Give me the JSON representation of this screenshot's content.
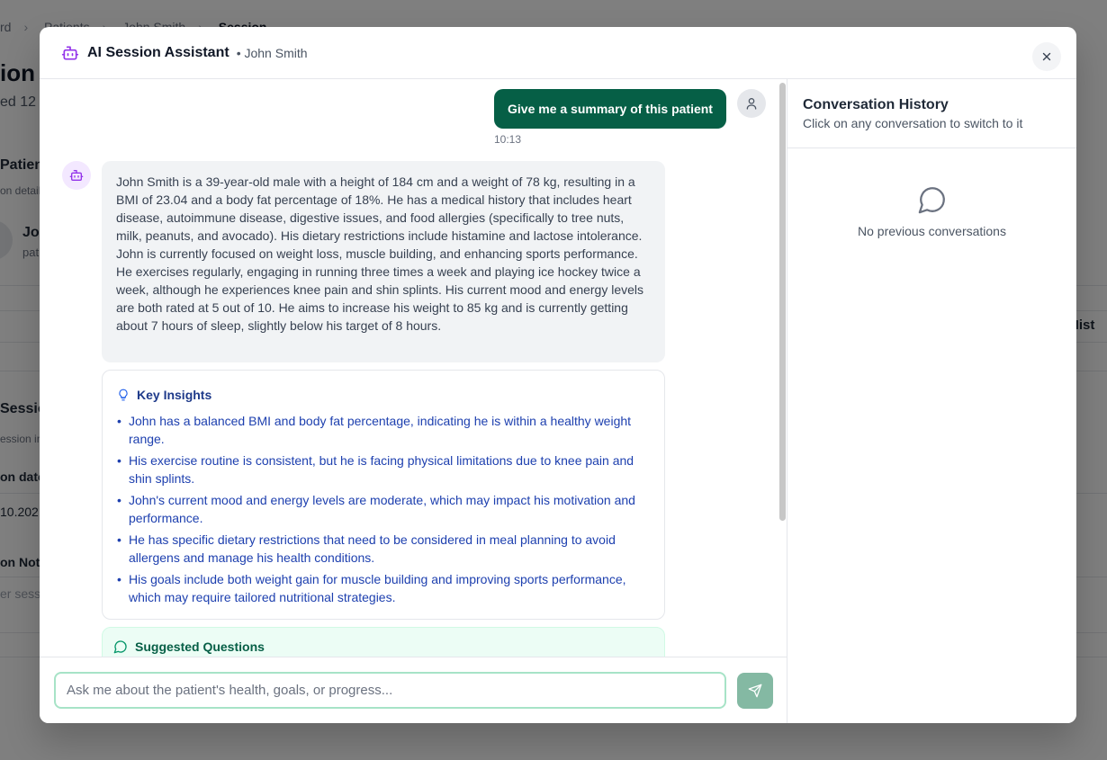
{
  "background": {
    "breadcrumb": [
      "rd",
      "Patients",
      "John Smith",
      "Session"
    ],
    "title": "ion",
    "subtitle": "ed 12",
    "patient_heading": "Patien",
    "patient_desc": "on detail",
    "patient_initials": "Jo",
    "patient_sub": "pat",
    "history_tab": "Hist",
    "session_heading": "Sessio",
    "session_desc": "ession in",
    "date_label": "on date",
    "date_value": "10.202",
    "notes_label": "on Not",
    "notes_value": "er sess"
  },
  "modal": {
    "title": "AI Session Assistant",
    "patient": "• John Smith",
    "close_label": "Close"
  },
  "chat": {
    "user_message": "Give me a summary of this patient",
    "user_time": "10:13",
    "assistant_message": "John Smith is a 39-year-old male with a height of 184 cm and a weight of 78 kg, resulting in a BMI of 23.04 and a body fat percentage of 18%. He has a medical history that includes heart disease, autoimmune disease, digestive issues, and food allergies (specifically to tree nuts, milk, peanuts, and avocado). His dietary restrictions include histamine and lactose intolerance. John is currently focused on weight loss, muscle building, and enhancing sports performance. He exercises regularly, engaging in running three times a week and playing ice hockey twice a week, although he experiences knee pain and shin splints. His current mood and energy levels are both rated at 5 out of 10. He aims to increase his weight to 85 kg and is currently getting about 7 hours of sleep, slightly below his target of 8 hours.",
    "insights_title": "Key Insights",
    "insights": [
      "John has a balanced BMI and body fat percentage, indicating he is within a healthy weight range.",
      "His exercise routine is consistent, but he is facing physical limitations due to knee pain and shin splints.",
      "John's current mood and energy levels are moderate, which may impact his motivation and performance.",
      "He has specific dietary restrictions that need to be considered in meal planning to avoid allergens and manage his health conditions.",
      "His goals include both weight gain for muscle building and improving sports performance, which may require tailored nutritional strategies."
    ],
    "suggested_title": "Suggested Questions",
    "input_placeholder": "Ask me about the patient's health, goals, or progress..."
  },
  "history": {
    "title": "Conversation History",
    "subtitle": "Click on any conversation to switch to it",
    "empty_text": "No previous conversations"
  },
  "colors": {
    "accent": "#065f46",
    "robot": "#9333ea",
    "insight_text": "#1e40af",
    "send_button": "#84b9a3"
  },
  "icons": [
    "robot-icon",
    "user-icon",
    "close-icon",
    "lightbulb-icon",
    "chat-bubble-icon",
    "send-icon"
  ]
}
